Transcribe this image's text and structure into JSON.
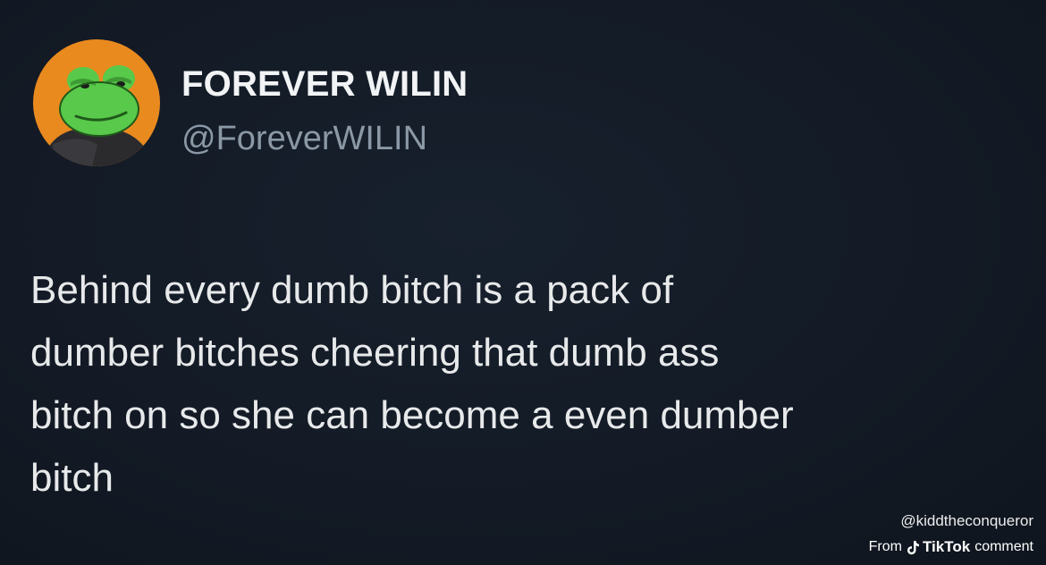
{
  "tweet": {
    "display_name": "FOREVER WILIN",
    "handle": "@ForeverWILIN",
    "text_lines": [
      "Behind every dumb bitch is a pack of",
      "dumber bitches cheering that dumb ass",
      "bitch on so she can become a even dumber",
      "bitch"
    ],
    "avatar_icon": "green-cartoon-frog-avatar"
  },
  "watermark": {
    "username": "@kiddtheconqueror",
    "from_label": "From",
    "brand": "TikTok",
    "suffix": "comment",
    "brand_icon": "tiktok-note-icon"
  },
  "colors": {
    "background": "#141c28",
    "name": "#f1f3f5",
    "handle": "#8b98a5",
    "avatar_bg": "#e98a1f",
    "frog_green": "#58c94a"
  }
}
